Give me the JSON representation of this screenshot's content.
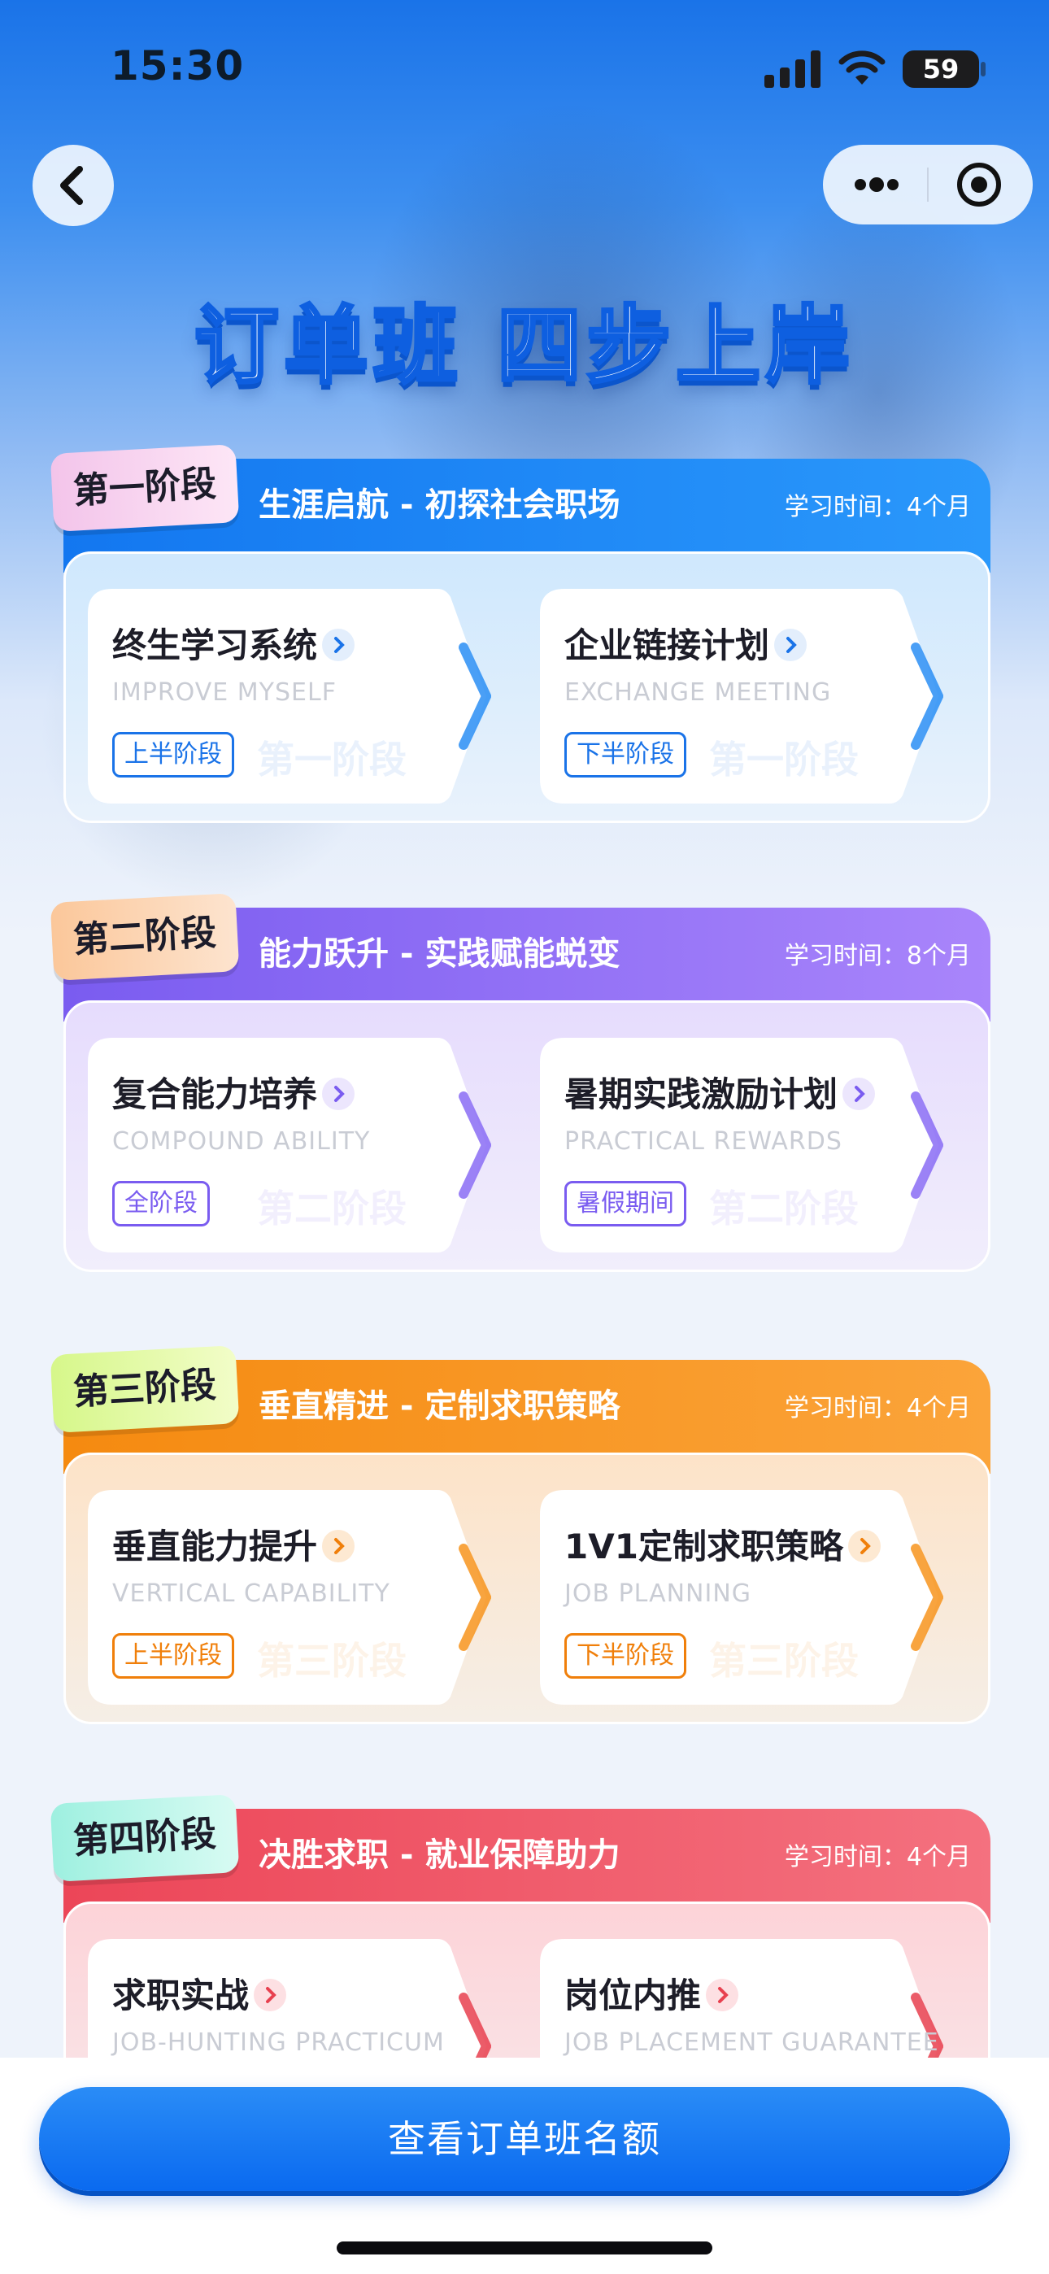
{
  "status_bar": {
    "time": "15:30",
    "battery": "59"
  },
  "hero": {
    "title": "订单班  四步上岸"
  },
  "time_prefix": "学习时间：",
  "colors": {
    "accent": "#1a73e8",
    "stage1": "#1e86f5",
    "stage2": "#8a6cf5",
    "stage3": "#f7941d",
    "stage4": "#ee5365"
  },
  "stages": [
    {
      "badge": "第一阶段",
      "name": "生涯启航 - 初探社会职场",
      "time": "学习时间：4个月",
      "cards": [
        {
          "title": "终生学习系统",
          "subtitle": "IMPROVE MYSELF",
          "tag": "上半阶段",
          "watermark": "第一阶段"
        },
        {
          "title": "企业链接计划",
          "subtitle": "EXCHANGE MEETING",
          "tag": "下半阶段",
          "watermark": "第一阶段"
        }
      ]
    },
    {
      "badge": "第二阶段",
      "name": "能力跃升 - 实践赋能蜕变",
      "time": "学习时间：8个月",
      "cards": [
        {
          "title": "复合能力培养",
          "subtitle": "COMPOUND ABILITY",
          "tag": "全阶段",
          "watermark": "第二阶段"
        },
        {
          "title": "暑期实践激励计划",
          "subtitle": "PRACTICAL REWARDS",
          "tag": "暑假期间",
          "watermark": "第二阶段"
        }
      ]
    },
    {
      "badge": "第三阶段",
      "name": "垂直精进 - 定制求职策略",
      "time": "学习时间：4个月",
      "cards": [
        {
          "title": "垂直能力提升",
          "subtitle": "VERTICAL CAPABILITY",
          "tag": "上半阶段",
          "watermark": "第三阶段"
        },
        {
          "title": "1V1定制求职策略",
          "subtitle": "JOB PLANNING",
          "tag": "下半阶段",
          "watermark": "第三阶段"
        }
      ]
    },
    {
      "badge": "第四阶段",
      "name": "决胜求职 - 就业保障助力",
      "time": "学习时间：4个月",
      "cards": [
        {
          "title": "求职实战",
          "subtitle": "JOB-HUNTING PRACTICUM"
        },
        {
          "title": "岗位内推",
          "subtitle": "JOB PLACEMENT GUARANTEE"
        }
      ]
    }
  ],
  "cta": {
    "label": "查看订单班名额"
  }
}
